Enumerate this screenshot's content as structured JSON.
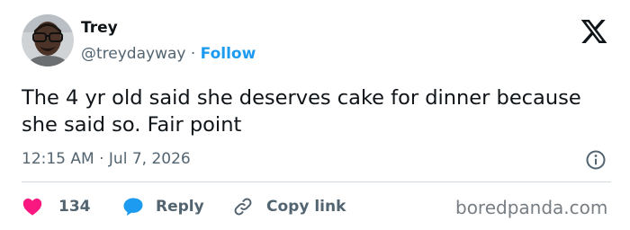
{
  "author": {
    "name": "Trey",
    "handle": "@treydayway",
    "separator": "·",
    "follow_label": "Follow"
  },
  "tweet": {
    "text": "The 4 yr old said she deserves cake for dinner because she said so. Fair point",
    "time": "12:15 AM",
    "meta_separator": "·",
    "date": "Jul 7, 2026"
  },
  "actions": {
    "like_count": "134",
    "reply_label": "Reply",
    "copy_label": "Copy link"
  },
  "icons": {
    "logo": "x-logo-icon",
    "info": "info-icon",
    "like": "heart-icon",
    "reply": "speech-bubble-icon",
    "copy": "link-icon"
  },
  "watermark": "boredpanda.com",
  "colors": {
    "text": "#0f1419",
    "secondary": "#536471",
    "follow": "#1d9bf0",
    "heart": "#f91880",
    "reply_bubble": "#1d9bf0",
    "divider": "#cfd9de",
    "watermark": "#777e84"
  }
}
